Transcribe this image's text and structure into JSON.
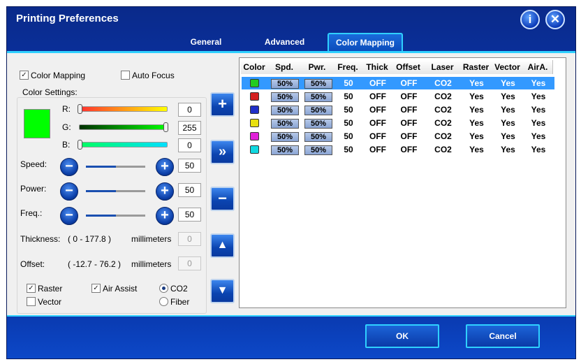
{
  "window": {
    "title": "Printing Preferences",
    "info_glyph": "i",
    "close_glyph": "✕"
  },
  "tabs": [
    "General",
    "Advanced",
    "Color Mapping"
  ],
  "active_tab": "Color Mapping",
  "checks": {
    "color_mapping": "Color Mapping",
    "auto_focus": "Auto Focus",
    "raster": "Raster",
    "vector": "Vector",
    "air_assist": "Air Assist"
  },
  "check_state": {
    "color_mapping": true,
    "auto_focus": false,
    "raster": true,
    "vector": false,
    "air_assist": true
  },
  "radios": {
    "co2": "CO2",
    "fiber": "Fiber",
    "selected": "CO2"
  },
  "color_settings": {
    "group_label": "Color Settings:",
    "preview_color": "#00ff00",
    "r": {
      "label": "R:",
      "value": "0"
    },
    "g": {
      "label": "G:",
      "value": "255"
    },
    "b": {
      "label": "B:",
      "value": "0"
    }
  },
  "params": {
    "speed": {
      "label": "Speed:",
      "value": "50"
    },
    "power": {
      "label": "Power:",
      "value": "50"
    },
    "freq": {
      "label": "Freq.:",
      "value": "50"
    }
  },
  "thickness": {
    "label": "Thickness:",
    "range": "( 0   -   177.8 )",
    "unit": "millimeters",
    "value": "0"
  },
  "offset": {
    "label": "Offset:",
    "range": "( -12.7   -   76.2 )",
    "unit": "millimeters",
    "value": "0"
  },
  "side_buttons": {
    "add": "+",
    "apply": "»",
    "remove": "−",
    "up": "▲",
    "down": "▼"
  },
  "stepper": {
    "minus": "−",
    "plus": "+"
  },
  "table": {
    "columns": [
      "Color",
      "Spd.",
      "Pwr.",
      "Freq.",
      "Thick",
      "Offset",
      "Laser",
      "Raster",
      "Vector",
      "AirA."
    ],
    "rows": [
      {
        "color": "#22cc22",
        "spd": "50%",
        "pwr": "50%",
        "freq": "50",
        "thick": "OFF",
        "offset": "OFF",
        "laser": "CO2",
        "raster": "Yes",
        "vector": "Yes",
        "aira": "Yes"
      },
      {
        "color": "#d42020",
        "spd": "50%",
        "pwr": "50%",
        "freq": "50",
        "thick": "OFF",
        "offset": "OFF",
        "laser": "CO2",
        "raster": "Yes",
        "vector": "Yes",
        "aira": "Yes"
      },
      {
        "color": "#2030c8",
        "spd": "50%",
        "pwr": "50%",
        "freq": "50",
        "thick": "OFF",
        "offset": "OFF",
        "laser": "CO2",
        "raster": "Yes",
        "vector": "Yes",
        "aira": "Yes"
      },
      {
        "color": "#e8e010",
        "spd": "50%",
        "pwr": "50%",
        "freq": "50",
        "thick": "OFF",
        "offset": "OFF",
        "laser": "CO2",
        "raster": "Yes",
        "vector": "Yes",
        "aira": "Yes"
      },
      {
        "color": "#e020d8",
        "spd": "50%",
        "pwr": "50%",
        "freq": "50",
        "thick": "OFF",
        "offset": "OFF",
        "laser": "CO2",
        "raster": "Yes",
        "vector": "Yes",
        "aira": "Yes"
      },
      {
        "color": "#10d8e0",
        "spd": "50%",
        "pwr": "50%",
        "freq": "50",
        "thick": "OFF",
        "offset": "OFF",
        "laser": "CO2",
        "raster": "Yes",
        "vector": "Yes",
        "aira": "Yes"
      }
    ],
    "selected_row": 0
  },
  "footer": {
    "ok": "OK",
    "cancel": "Cancel"
  }
}
